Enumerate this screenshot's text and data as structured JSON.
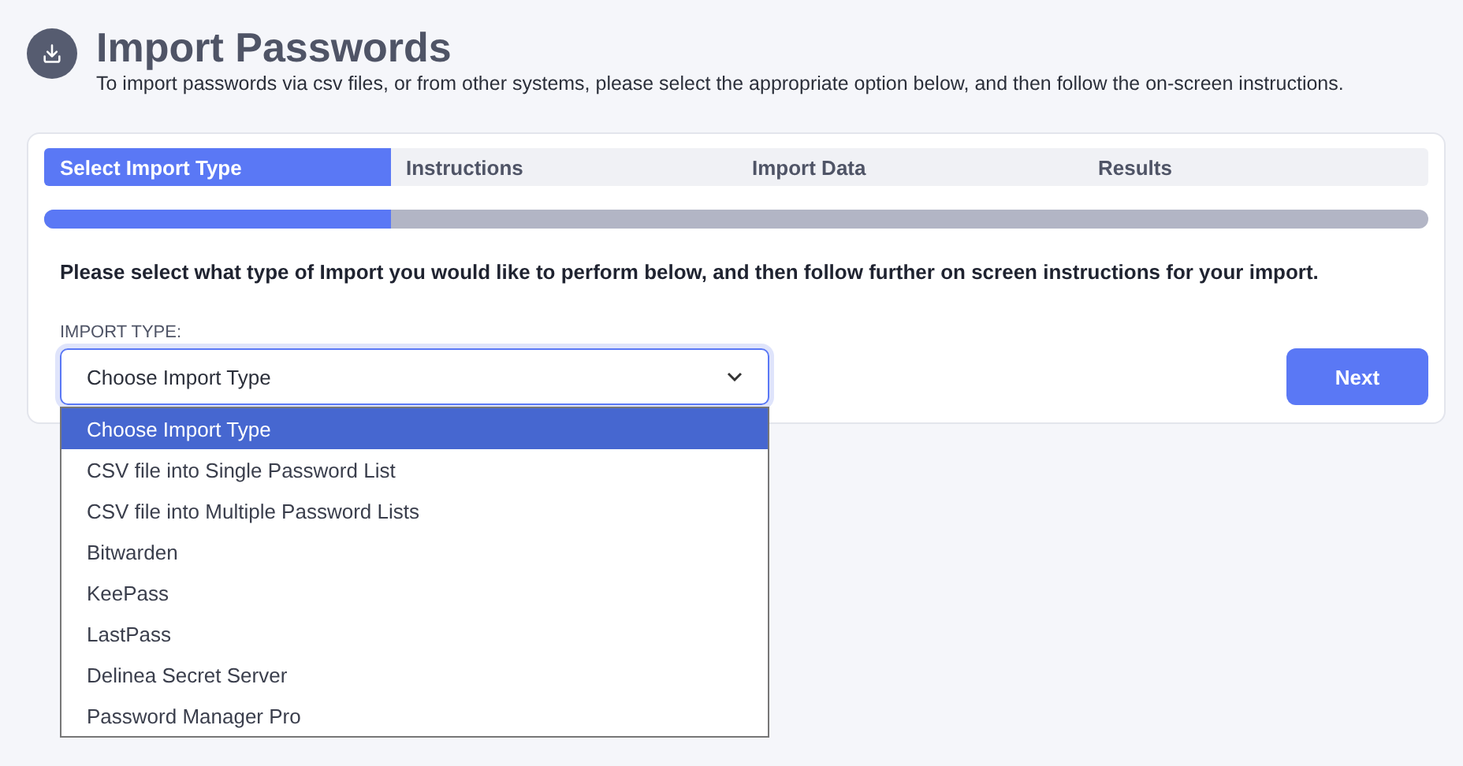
{
  "header": {
    "title": "Import Passwords",
    "subtitle": "To import passwords via csv files, or from other systems, please select the appropriate option below, and then follow the on-screen instructions."
  },
  "steps": [
    {
      "label": "Select Import Type",
      "selected": true
    },
    {
      "label": "Instructions",
      "selected": false
    },
    {
      "label": "Import Data",
      "selected": false
    },
    {
      "label": "Results",
      "selected": false
    }
  ],
  "progress": {
    "level": 0.25
  },
  "intro": "Please select what type of Import you would like to perform below, and then follow further on screen instructions for your import.",
  "import_type": {
    "label": "IMPORT TYPE:",
    "value": "Choose Import Type",
    "expanded": true,
    "options": [
      {
        "label": "Choose Import Type",
        "selected": true
      },
      {
        "label": "CSV file into Single Password List",
        "selected": false
      },
      {
        "label": "CSV file into Multiple Password Lists",
        "selected": false
      },
      {
        "label": "Bitwarden",
        "selected": false
      },
      {
        "label": "KeePass",
        "selected": false
      },
      {
        "label": "LastPass",
        "selected": false
      },
      {
        "label": "Delinea Secret Server",
        "selected": false
      },
      {
        "label": "Password Manager Pro",
        "selected": false
      }
    ]
  },
  "buttons": [
    {
      "label": "Next"
    }
  ]
}
